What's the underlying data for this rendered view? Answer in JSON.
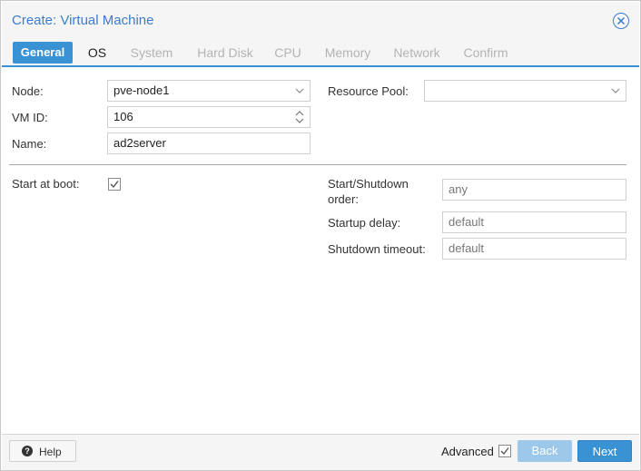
{
  "dialog": {
    "title": "Create: Virtual Machine"
  },
  "tabs": [
    {
      "label": "General",
      "state": "active"
    },
    {
      "label": "OS",
      "state": "enabled"
    },
    {
      "label": "System",
      "state": "disabled"
    },
    {
      "label": "Hard Disk",
      "state": "disabled"
    },
    {
      "label": "CPU",
      "state": "disabled"
    },
    {
      "label": "Memory",
      "state": "disabled"
    },
    {
      "label": "Network",
      "state": "disabled"
    },
    {
      "label": "Confirm",
      "state": "disabled"
    }
  ],
  "general": {
    "node_label": "Node:",
    "node_value": "pve-node1",
    "vmid_label": "VM ID:",
    "vmid_value": "106",
    "name_label": "Name:",
    "name_value": "ad2server",
    "pool_label": "Resource Pool:",
    "pool_value": ""
  },
  "advanced_section": {
    "start_at_boot_label": "Start at boot:",
    "start_at_boot_checked": true,
    "order_label_line1": "Start/Shutdown",
    "order_label_line2": "order:",
    "order_placeholder": "any",
    "startup_delay_label": "Startup delay:",
    "startup_delay_placeholder": "default",
    "shutdown_timeout_label": "Shutdown timeout:",
    "shutdown_timeout_placeholder": "default"
  },
  "footer": {
    "help_label": "Help",
    "advanced_label": "Advanced",
    "advanced_checked": true,
    "back_label": "Back",
    "next_label": "Next"
  },
  "colors": {
    "accent": "#3892d4",
    "title": "#3b7dcc",
    "back_disabled": "#9ec8ea"
  }
}
